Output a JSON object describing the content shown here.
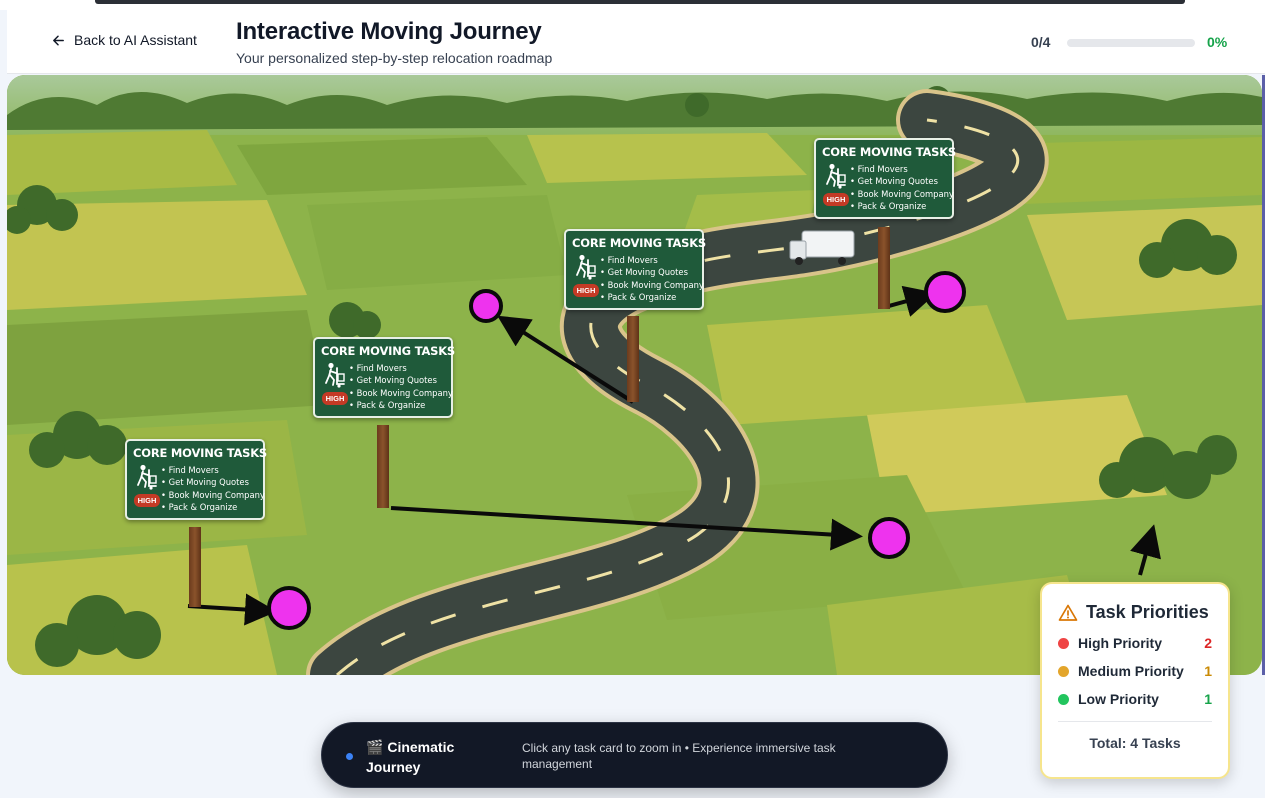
{
  "header": {
    "back_label": "Back to AI Assistant",
    "title": "Interactive Moving Journey",
    "subtitle": "Your personalized step-by-step relocation roadmap",
    "progress_count": "0/4",
    "progress_percent": "0%",
    "progress_value": 0
  },
  "signs": [
    {
      "title": "CORE MOVING TASKS",
      "badge": "HIGH",
      "items": [
        "Find Movers",
        "Get Moving Quotes",
        "Book Moving Company",
        "Pack & Organize"
      ]
    },
    {
      "title": "CORE MOVING TASKS",
      "badge": "HIGH",
      "items": [
        "Find Movers",
        "Get Moving Quotes",
        "Book Moving Company",
        "Pack & Organize"
      ]
    },
    {
      "title": "CORE MOVING TASKS",
      "badge": "HIGH",
      "items": [
        "Find Movers",
        "Get Moving Quotes",
        "Book Moving Company",
        "Pack & Organize"
      ]
    },
    {
      "title": "CORE MOVING TASKS",
      "badge": "HIGH",
      "items": [
        "Find Movers",
        "Get Moving Quotes",
        "Book Moving Company",
        "Pack & Organize"
      ]
    }
  ],
  "priorities": {
    "title": "Task Priorities",
    "rows": [
      {
        "label": "High Priority",
        "count": "2",
        "color": "#ef4444"
      },
      {
        "label": "Medium Priority",
        "count": "1",
        "color": "#e3a52b"
      },
      {
        "label": "Low Priority",
        "count": "1",
        "color": "#22c55e"
      }
    ],
    "total": "Total: 4 Tasks"
  },
  "cinematic": {
    "icon": "🎬",
    "title": "Cinematic Journey",
    "description": "Click any task card to zoom in • Experience immersive task management"
  },
  "colors": {
    "accent_green": "#16a34a",
    "sign_green": "#1f5a3a",
    "marker_magenta": "#ee33ee",
    "high_badge": "#c43a25"
  },
  "icons": [
    "arrow-left-icon",
    "mover-dolly-icon",
    "warning-triangle-icon",
    "clapper-icon",
    "truck-icon"
  ]
}
